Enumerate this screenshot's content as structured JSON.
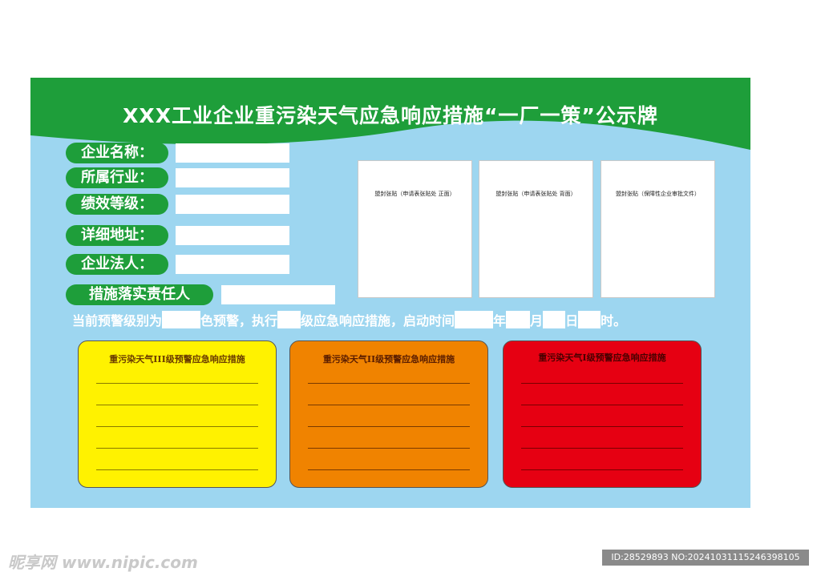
{
  "board": {
    "title": "XXX工业企业重污染天气应急响应措施“一厂一策”公示牌",
    "colors": {
      "green": "#1e9e3a",
      "sky": "#9dd6f0",
      "yellow": "#fff200",
      "orange": "#f08300",
      "red": "#e60012"
    }
  },
  "fields": [
    {
      "label": "企业名称："
    },
    {
      "label": "所属行业："
    },
    {
      "label": "绩效等级："
    },
    {
      "label": "详细地址："
    },
    {
      "label": "企业法人："
    },
    {
      "label": "措施落实责任人"
    }
  ],
  "notices": [
    {
      "label": "盟封张贴（申请表张贴处 正面）"
    },
    {
      "label": "盟封张贴（申请表张贴处 背面）"
    },
    {
      "label": "盟封张贴（保障性企业审批文件）"
    }
  ],
  "status": {
    "t1": "当前预警级别为",
    "t2": "色预警，执行",
    "t3": "级应急响应措施，启动时间",
    "t4": "年",
    "t5": "月",
    "t6": "日",
    "t7": "时。"
  },
  "panels": [
    {
      "title": "重污染天气III级预警应急响应措施",
      "color": "#fff200",
      "text_color": "#6a3b00"
    },
    {
      "title": "重污染天气II级预警应急响应措施",
      "color": "#f08300",
      "text_color": "#5a1d00"
    },
    {
      "title": "重污染天气I级预警应急响应措施",
      "color": "#e60012",
      "text_color": "#4a0000"
    }
  ],
  "footer": {
    "watermark": "昵享网 www.nipic.com",
    "id_text": "ID:28529893 NO:20241031115246398105"
  }
}
